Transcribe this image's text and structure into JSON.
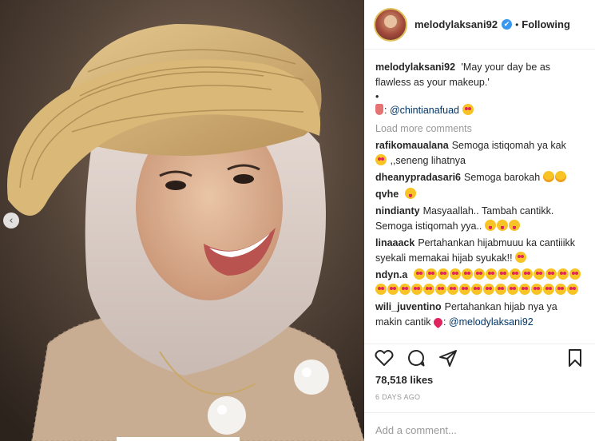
{
  "post": {
    "username": "melodylaksani92",
    "verified_badge": "✔",
    "separator": "•",
    "follow_state": "Following",
    "caption": {
      "user": "melodylaksani92",
      "text": "'May your day be as flawless as your makeup.'",
      "bullet": "•",
      "mention": "@chintianafuad"
    },
    "load_more": "Load more comments",
    "comments": [
      {
        "user": "rafikomaualana",
        "text": "Semoga istiqomah ya kak",
        "text2": " ,,seneng lihatnya"
      },
      {
        "user": "dheanypradasari6",
        "text": "Semoga barokah"
      },
      {
        "user": "qvhe",
        "text": ""
      },
      {
        "user": "nindianty",
        "text": "Masyaallah.. Tambah cantikk. Semoga istiqomah yya.."
      },
      {
        "user": "linaaack",
        "text": "Pertahankan hijabmuuu ka cantiiikk syekali memakai hijab syukak!!"
      },
      {
        "user": "ndyn.a",
        "text": ""
      },
      {
        "user": "wili_juventino",
        "text": "Pertahankan hijab nya ya",
        "text2": "makin cantik",
        "mention": "@melodylaksani92"
      }
    ],
    "likes": "78,518 likes",
    "time": "6 DAYS AGO",
    "add_comment_placeholder": "Add a comment...",
    "carousel_prev": "‹"
  },
  "colors": {
    "mention": "#003569",
    "verified": "#3897f0",
    "muted": "#999999",
    "text": "#262626"
  },
  "icons": [
    "heart-icon",
    "comment-icon",
    "share-icon",
    "bookmark-icon",
    "verified-icon",
    "chevron-left-icon"
  ]
}
